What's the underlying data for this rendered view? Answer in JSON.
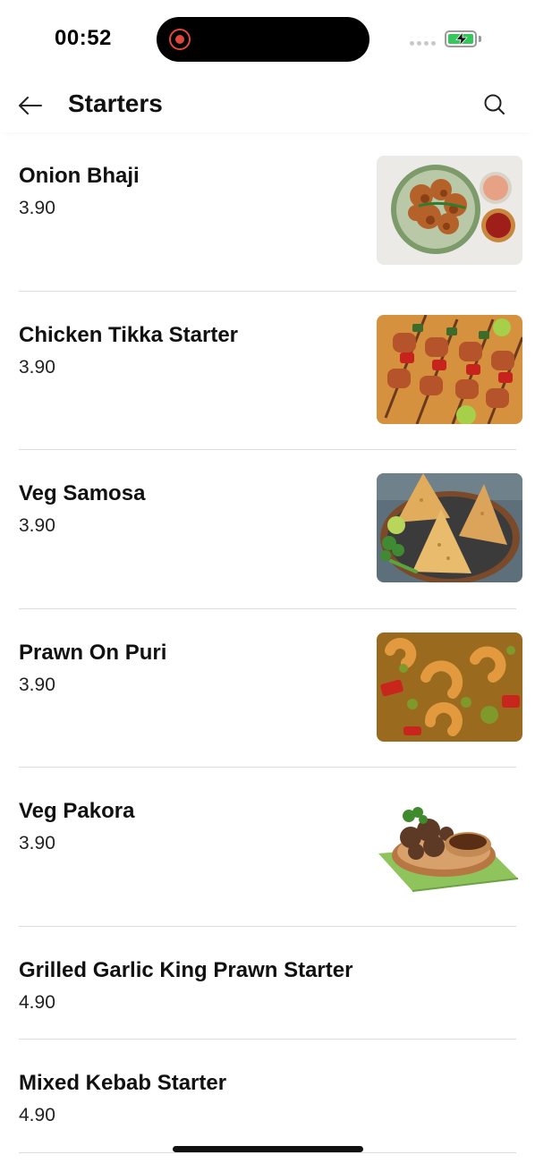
{
  "status_bar": {
    "time": "00:52",
    "recording_indicator": "recording-dot-icon",
    "battery_state": "charging"
  },
  "header": {
    "title": "Starters",
    "back_icon": "arrow-left-icon",
    "search_icon": "search-icon"
  },
  "items": [
    {
      "name": "Onion Bhaji",
      "price": "3.90",
      "image": "onion-bhaji-photo"
    },
    {
      "name": "Chicken Tikka Starter",
      "price": "3.90",
      "image": "chicken-tikka-photo"
    },
    {
      "name": "Veg Samosa",
      "price": "3.90",
      "image": "veg-samosa-photo"
    },
    {
      "name": "Prawn On Puri",
      "price": "3.90",
      "image": "prawn-on-puri-photo"
    },
    {
      "name": "Veg Pakora",
      "price": "3.90",
      "image": "veg-pakora-photo"
    },
    {
      "name": "Grilled Garlic King Prawn Starter",
      "price": "4.90"
    },
    {
      "name": "Mixed Kebab Starter",
      "price": "4.90"
    }
  ],
  "colors": {
    "text": "#111111",
    "divider": "#dcdcdc",
    "battery_green": "#35c759",
    "record_red": "#e0463c"
  }
}
